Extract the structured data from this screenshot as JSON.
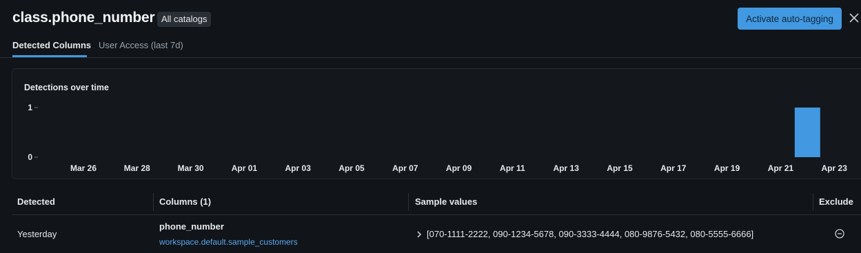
{
  "header": {
    "title": "class.phone_number",
    "catalog_badge": "All catalogs",
    "activate_label": "Activate auto-tagging"
  },
  "tabs": [
    {
      "label": "Detected Columns",
      "active": true
    },
    {
      "label": "User Access (last 7d)",
      "active": false
    }
  ],
  "chart_panel": {
    "title": "Detections over time"
  },
  "chart_data": {
    "type": "bar",
    "title": "Detections over time",
    "x_tick_labels": [
      "Mar 26",
      "Mar 28",
      "Mar 30",
      "Apr 01",
      "Apr 03",
      "Apr 05",
      "Apr 07",
      "Apr 09",
      "Apr 11",
      "Apr 13",
      "Apr 15",
      "Apr 17",
      "Apr 19",
      "Apr 21",
      "Apr 23"
    ],
    "y_ticks": [
      0,
      1
    ],
    "ylim": [
      0,
      1
    ],
    "categories": [
      "Apr 22"
    ],
    "values": [
      1
    ],
    "bar_color": "#4299e1",
    "grid": false
  },
  "table": {
    "headers": {
      "detected": "Detected",
      "columns": "Columns (1)",
      "samples": "Sample values",
      "exclude": "Exclude"
    },
    "rows": [
      {
        "detected": "Yesterday",
        "column_name": "phone_number",
        "column_path": "workspace.default.sample_customers",
        "sample_values": "[070-1111-2222, 090-1234-5678, 090-3333-4444, 080-9876-5432, 080-5555-6666]"
      }
    ]
  },
  "colors": {
    "accent": "#4299e1",
    "background": "#111418",
    "link": "#5aa8ef"
  },
  "icons": {
    "close": "close-icon",
    "expand": "chevron-right-icon",
    "exclude": "minus-circle-icon"
  }
}
